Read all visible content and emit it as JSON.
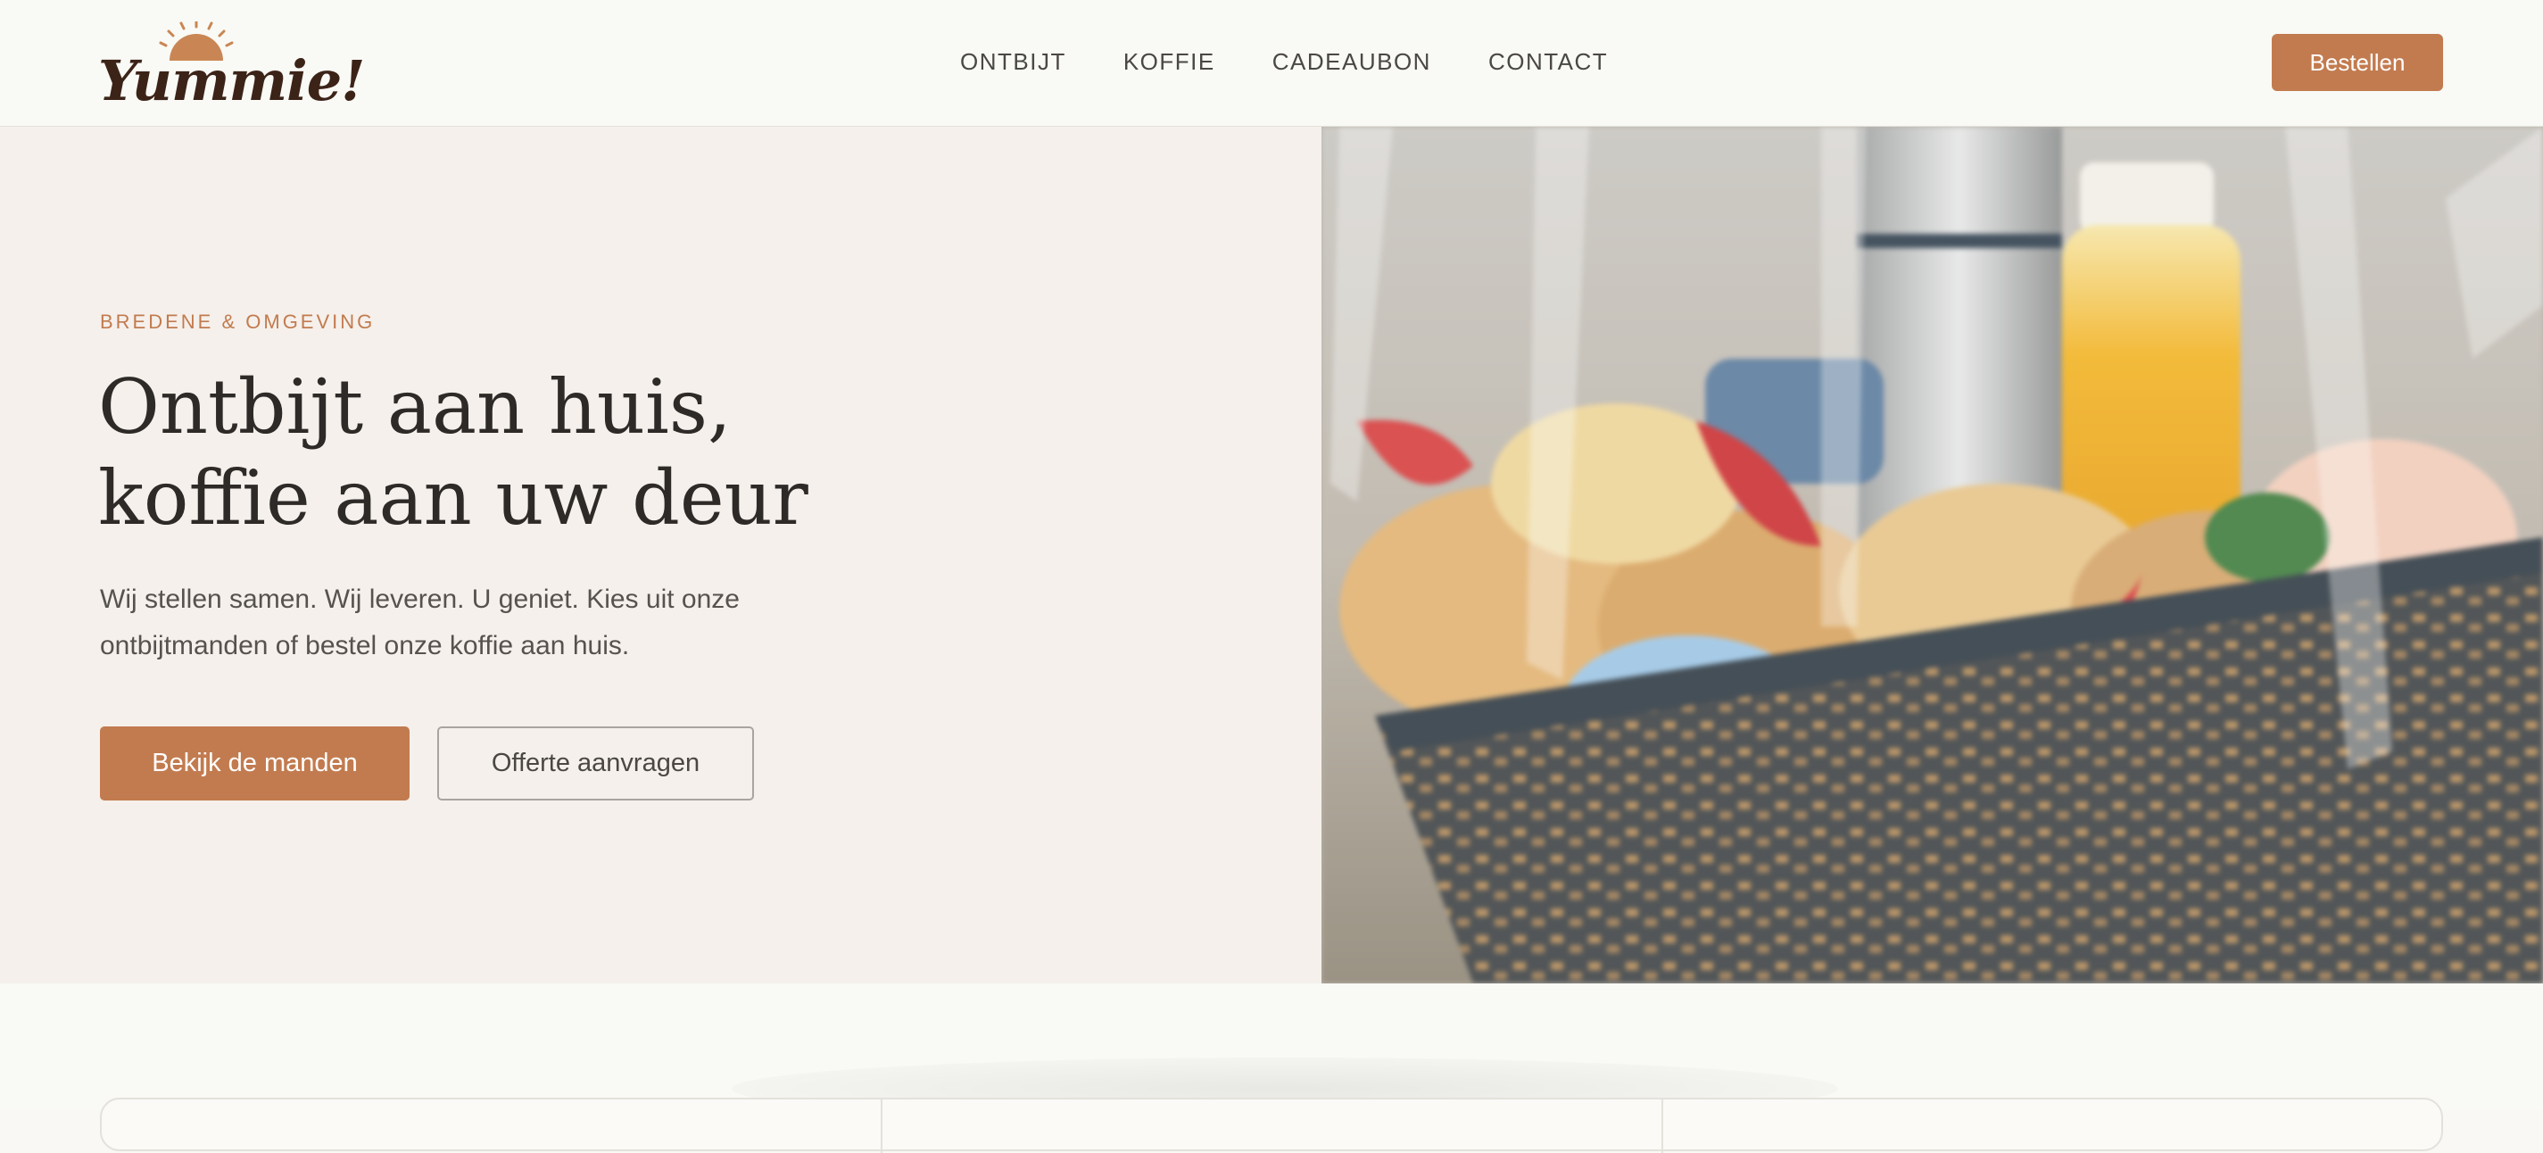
{
  "brand": {
    "name": "Yummie!",
    "colors": {
      "accent": "#c27b4f",
      "dark_text": "#2d2a28",
      "logo_brown": "#3c2318",
      "hero_bg": "#f5f0eb"
    }
  },
  "nav": {
    "items": [
      {
        "label": "ONTBIJT"
      },
      {
        "label": "KOFFIE"
      },
      {
        "label": "CADEAUBON"
      },
      {
        "label": "CONTACT"
      }
    ],
    "cta_label": "Bestellen"
  },
  "hero": {
    "eyebrow": "BREDENE & OMGEVING",
    "headline_line1": "Ontbijt aan huis,",
    "headline_line2": "koffie aan uw deur",
    "lead": "Wij stellen samen. Wij leveren. U geniet. Kies uit onze ontbijtmanden of bestel onze koffie aan huis.",
    "primary_button": "Bekijk de manden",
    "secondary_button": "Offerte aanvragen",
    "image_subject": "breakfast-basket-photo"
  },
  "icons": {
    "logo_sun": "sun-icon"
  }
}
